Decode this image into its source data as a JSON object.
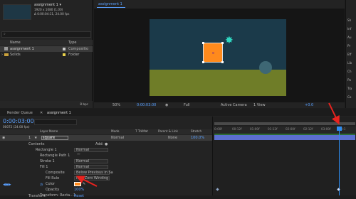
{
  "project": {
    "comp_name": "assignment 1 ▾",
    "comp_info": "1920 x 1080 (1.00)",
    "comp_duration": "Δ 0:00:04:11, 24.00 fps",
    "col_name": "Name",
    "col_type": "Type",
    "items": [
      {
        "name": "assignment 1",
        "type": "Compositio"
      },
      {
        "name": "Solids",
        "type": "Folder"
      }
    ],
    "footer_bpc": "8 bpc"
  },
  "viewer": {
    "tab": "assignment 1",
    "zoom": "50%",
    "time": "0:00:03:00",
    "quality": "Full",
    "camera": "Active Camera",
    "views": "1 View",
    "exposure": "+0.0"
  },
  "right_panel": {
    "items": [
      "Sh",
      "Inf",
      "Au",
      "Pr",
      "Eff",
      "Lib",
      "Ch",
      "Pa",
      "Tra",
      "Co"
    ]
  },
  "timeline": {
    "tabs": [
      "Render Queue",
      "assignment 1"
    ],
    "current_time": "0:00:03:00",
    "frames": "00072 (24.00 fps)",
    "headers": {
      "layer_name": "Layer Name",
      "mode": "Mode",
      "trkmat": "T TrkMat",
      "parent": "Parent & Link",
      "stretch": "Stretch"
    },
    "layer": {
      "index": "1",
      "name": "square",
      "mode": "Normal",
      "parent": "None",
      "stretch": "100.0%"
    },
    "rows": [
      {
        "label": "Contents",
        "value": "",
        "extra": "Add: ●"
      },
      {
        "label": "Rectangle 1",
        "value": "Normal",
        "extra": ""
      },
      {
        "label": "Rectangle Path 1",
        "value": "‘‘‘",
        "extra": ""
      },
      {
        "label": "Stroke 1",
        "value": "Normal",
        "extra": ""
      },
      {
        "label": "Fill 1",
        "value": "Normal",
        "extra": ""
      },
      {
        "label": "Composite",
        "value": "Below Previous in Sa",
        "extra": ""
      },
      {
        "label": "Fill Rule",
        "value": "Non-Zero Winding",
        "extra": ""
      },
      {
        "label": "Color",
        "value": "",
        "extra": ""
      },
      {
        "label": "Opacity",
        "value": "100%",
        "extra": ""
      },
      {
        "label": "Transform: Recta...1",
        "value": "",
        "extra": ""
      },
      {
        "label": "Transform",
        "value": "Reset",
        "extra": ""
      }
    ],
    "ruler": [
      "0:00f",
      "00:12f",
      "01:00f",
      "01:12f",
      "02:00f",
      "02:12f",
      "03:00f",
      "03:1"
    ]
  },
  "colors": {
    "accent_blue": "#2d8cf0",
    "square_orange": "#ff8a1c",
    "comp_sky": "#1b3a4a",
    "comp_ground": "#6f7d28",
    "star_teal": "#2fd8c2",
    "annotation_red": "#e8231f"
  }
}
